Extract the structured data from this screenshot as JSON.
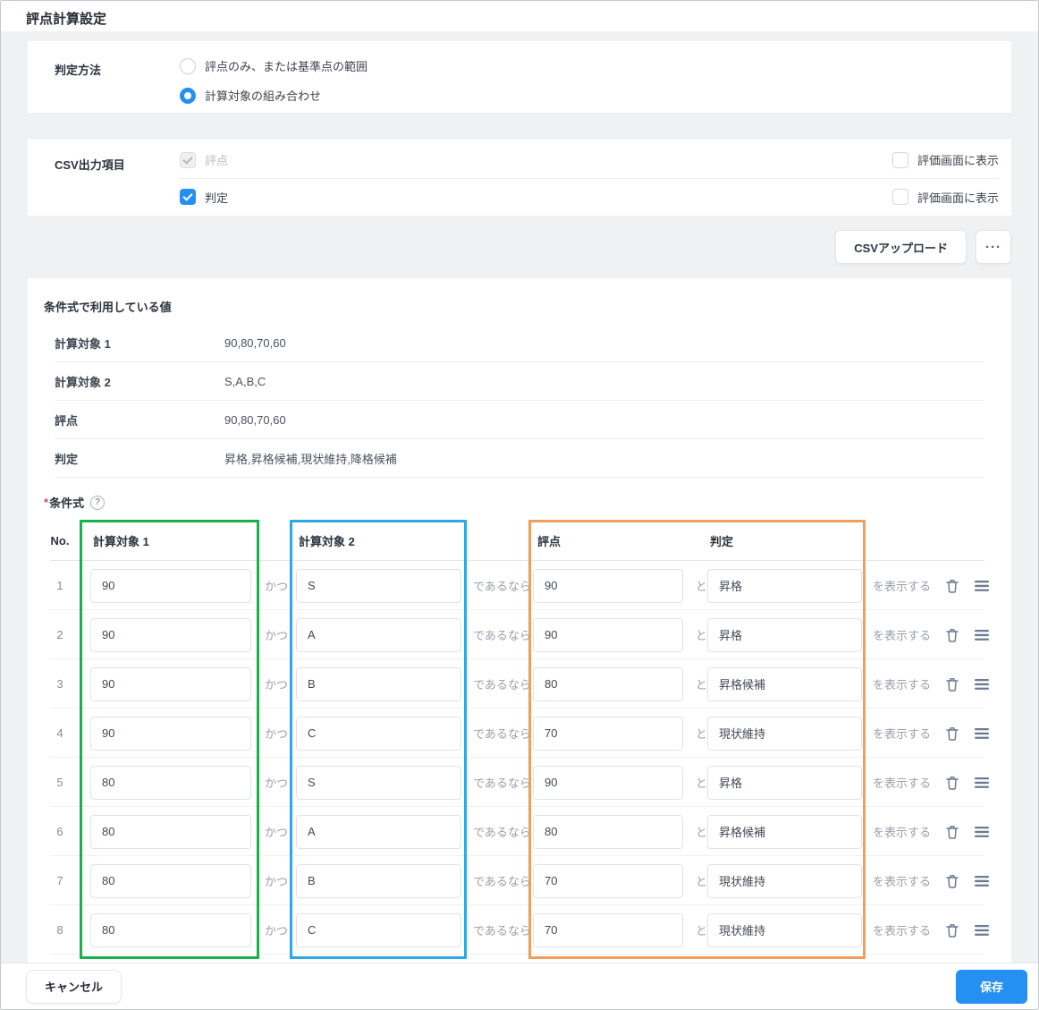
{
  "page": {
    "title": "評点計算設定"
  },
  "colors": {
    "accent": "#2590f2",
    "highlight_green": "#17b249",
    "highlight_blue": "#2ea7e6",
    "highlight_orange": "#ed9f5d"
  },
  "judgement_method": {
    "label": "判定方法",
    "options": [
      {
        "label": "評点のみ、または基準点の範囲",
        "selected": false
      },
      {
        "label": "計算対象の組み合わせ",
        "selected": true
      }
    ]
  },
  "csv_output": {
    "label": "CSV出力項目",
    "rows": [
      {
        "label": "評点",
        "checked": true,
        "disabled": true,
        "right_label": "評価画面に表示",
        "right_checked": false
      },
      {
        "label": "判定",
        "checked": true,
        "disabled": false,
        "right_label": "評価画面に表示",
        "right_checked": false
      }
    ]
  },
  "toolbar": {
    "csv_upload": "CSVアップロード",
    "more": "···"
  },
  "values_in_use": {
    "title": "条件式で利用している値",
    "rows": [
      {
        "label": "計算対象 1",
        "value": "90,80,70,60"
      },
      {
        "label": "計算対象 2",
        "value": "S,A,B,C"
      },
      {
        "label": "評点",
        "value": "90,80,70,60"
      },
      {
        "label": "判定",
        "value": "昇格,昇格候補,現状維持,降格候補"
      }
    ]
  },
  "conditions": {
    "required_mark": "*",
    "title": "条件式",
    "help": "?",
    "headers": {
      "no": "No.",
      "target1": "計算対象 1",
      "target2": "計算対象 2",
      "score": "評点",
      "judgement": "判定"
    },
    "connectors": {
      "and": "かつ",
      "then": "であるなら",
      "with": "と",
      "display": "を表示する"
    },
    "rows": [
      {
        "no": "1",
        "target1": "90",
        "target2": "S",
        "score": "90",
        "judgement": "昇格"
      },
      {
        "no": "2",
        "target1": "90",
        "target2": "A",
        "score": "90",
        "judgement": "昇格"
      },
      {
        "no": "3",
        "target1": "90",
        "target2": "B",
        "score": "80",
        "judgement": "昇格候補"
      },
      {
        "no": "4",
        "target1": "90",
        "target2": "C",
        "score": "70",
        "judgement": "現状維持"
      },
      {
        "no": "5",
        "target1": "80",
        "target2": "S",
        "score": "90",
        "judgement": "昇格"
      },
      {
        "no": "6",
        "target1": "80",
        "target2": "A",
        "score": "80",
        "judgement": "昇格候補"
      },
      {
        "no": "7",
        "target1": "80",
        "target2": "B",
        "score": "70",
        "judgement": "現状維持"
      },
      {
        "no": "8",
        "target1": "80",
        "target2": "C",
        "score": "70",
        "judgement": "現状維持"
      }
    ]
  },
  "footer": {
    "cancel": "キャンセル",
    "save": "保存"
  }
}
